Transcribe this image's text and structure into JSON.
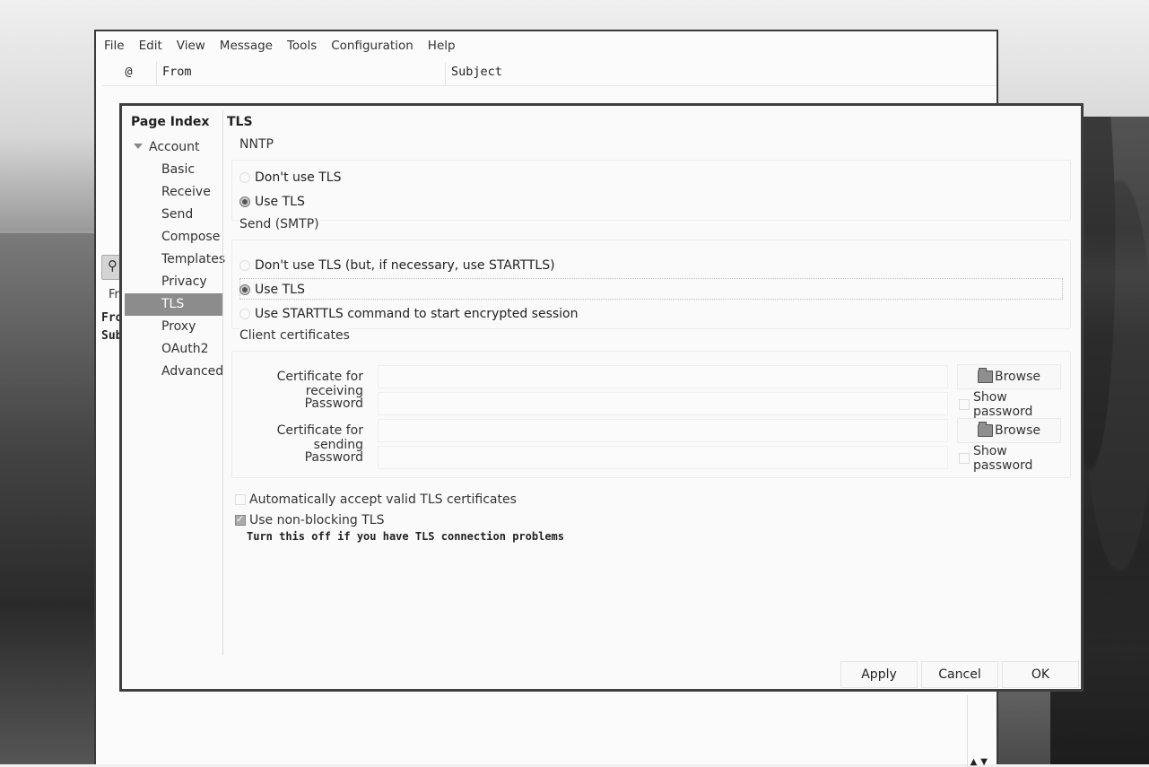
{
  "main_window": {
    "menu": [
      "File",
      "Edit",
      "View",
      "Message",
      "Tools",
      "Configuration",
      "Help"
    ],
    "columns": {
      "flag": "@",
      "from": "From",
      "subject": "Subject"
    },
    "fragments": {
      "fr": "Fr",
      "from": "Fro",
      "subject": "Sub"
    },
    "scroll_arrows": "▲▼"
  },
  "dialog": {
    "page_index_title": "Page Index",
    "tree": {
      "parent": "Account",
      "children": [
        "Basic",
        "Receive",
        "Send",
        "Compose",
        "Templates",
        "Privacy",
        "TLS",
        "Proxy",
        "OAuth2",
        "Advanced"
      ],
      "selected": "TLS"
    },
    "section_title": "TLS",
    "nntp": {
      "title": "NNTP",
      "options": [
        "Don't use TLS",
        "Use TLS"
      ],
      "selected": "Use TLS"
    },
    "smtp": {
      "title": "Send (SMTP)",
      "options": [
        "Don't use TLS (but, if necessary, use STARTTLS)",
        "Use TLS",
        "Use STARTTLS command to start encrypted session"
      ],
      "selected": "Use TLS"
    },
    "certs": {
      "title": "Client certificates",
      "receiving_label": "Certificate for receiving",
      "sending_label": "Certificate for sending",
      "password_label": "Password",
      "receiving_value": "",
      "receiving_password": "",
      "sending_value": "",
      "sending_password": "",
      "browse_label": "Browse",
      "show_password_label": "Show password"
    },
    "auto_accept": {
      "label": "Automatically accept valid TLS certificates",
      "checked": false
    },
    "non_blocking": {
      "label": "Use non-blocking TLS",
      "checked": true
    },
    "hint": "Turn this off if you have TLS connection problems",
    "buttons": {
      "apply": "Apply",
      "cancel": "Cancel",
      "ok": "OK"
    }
  }
}
